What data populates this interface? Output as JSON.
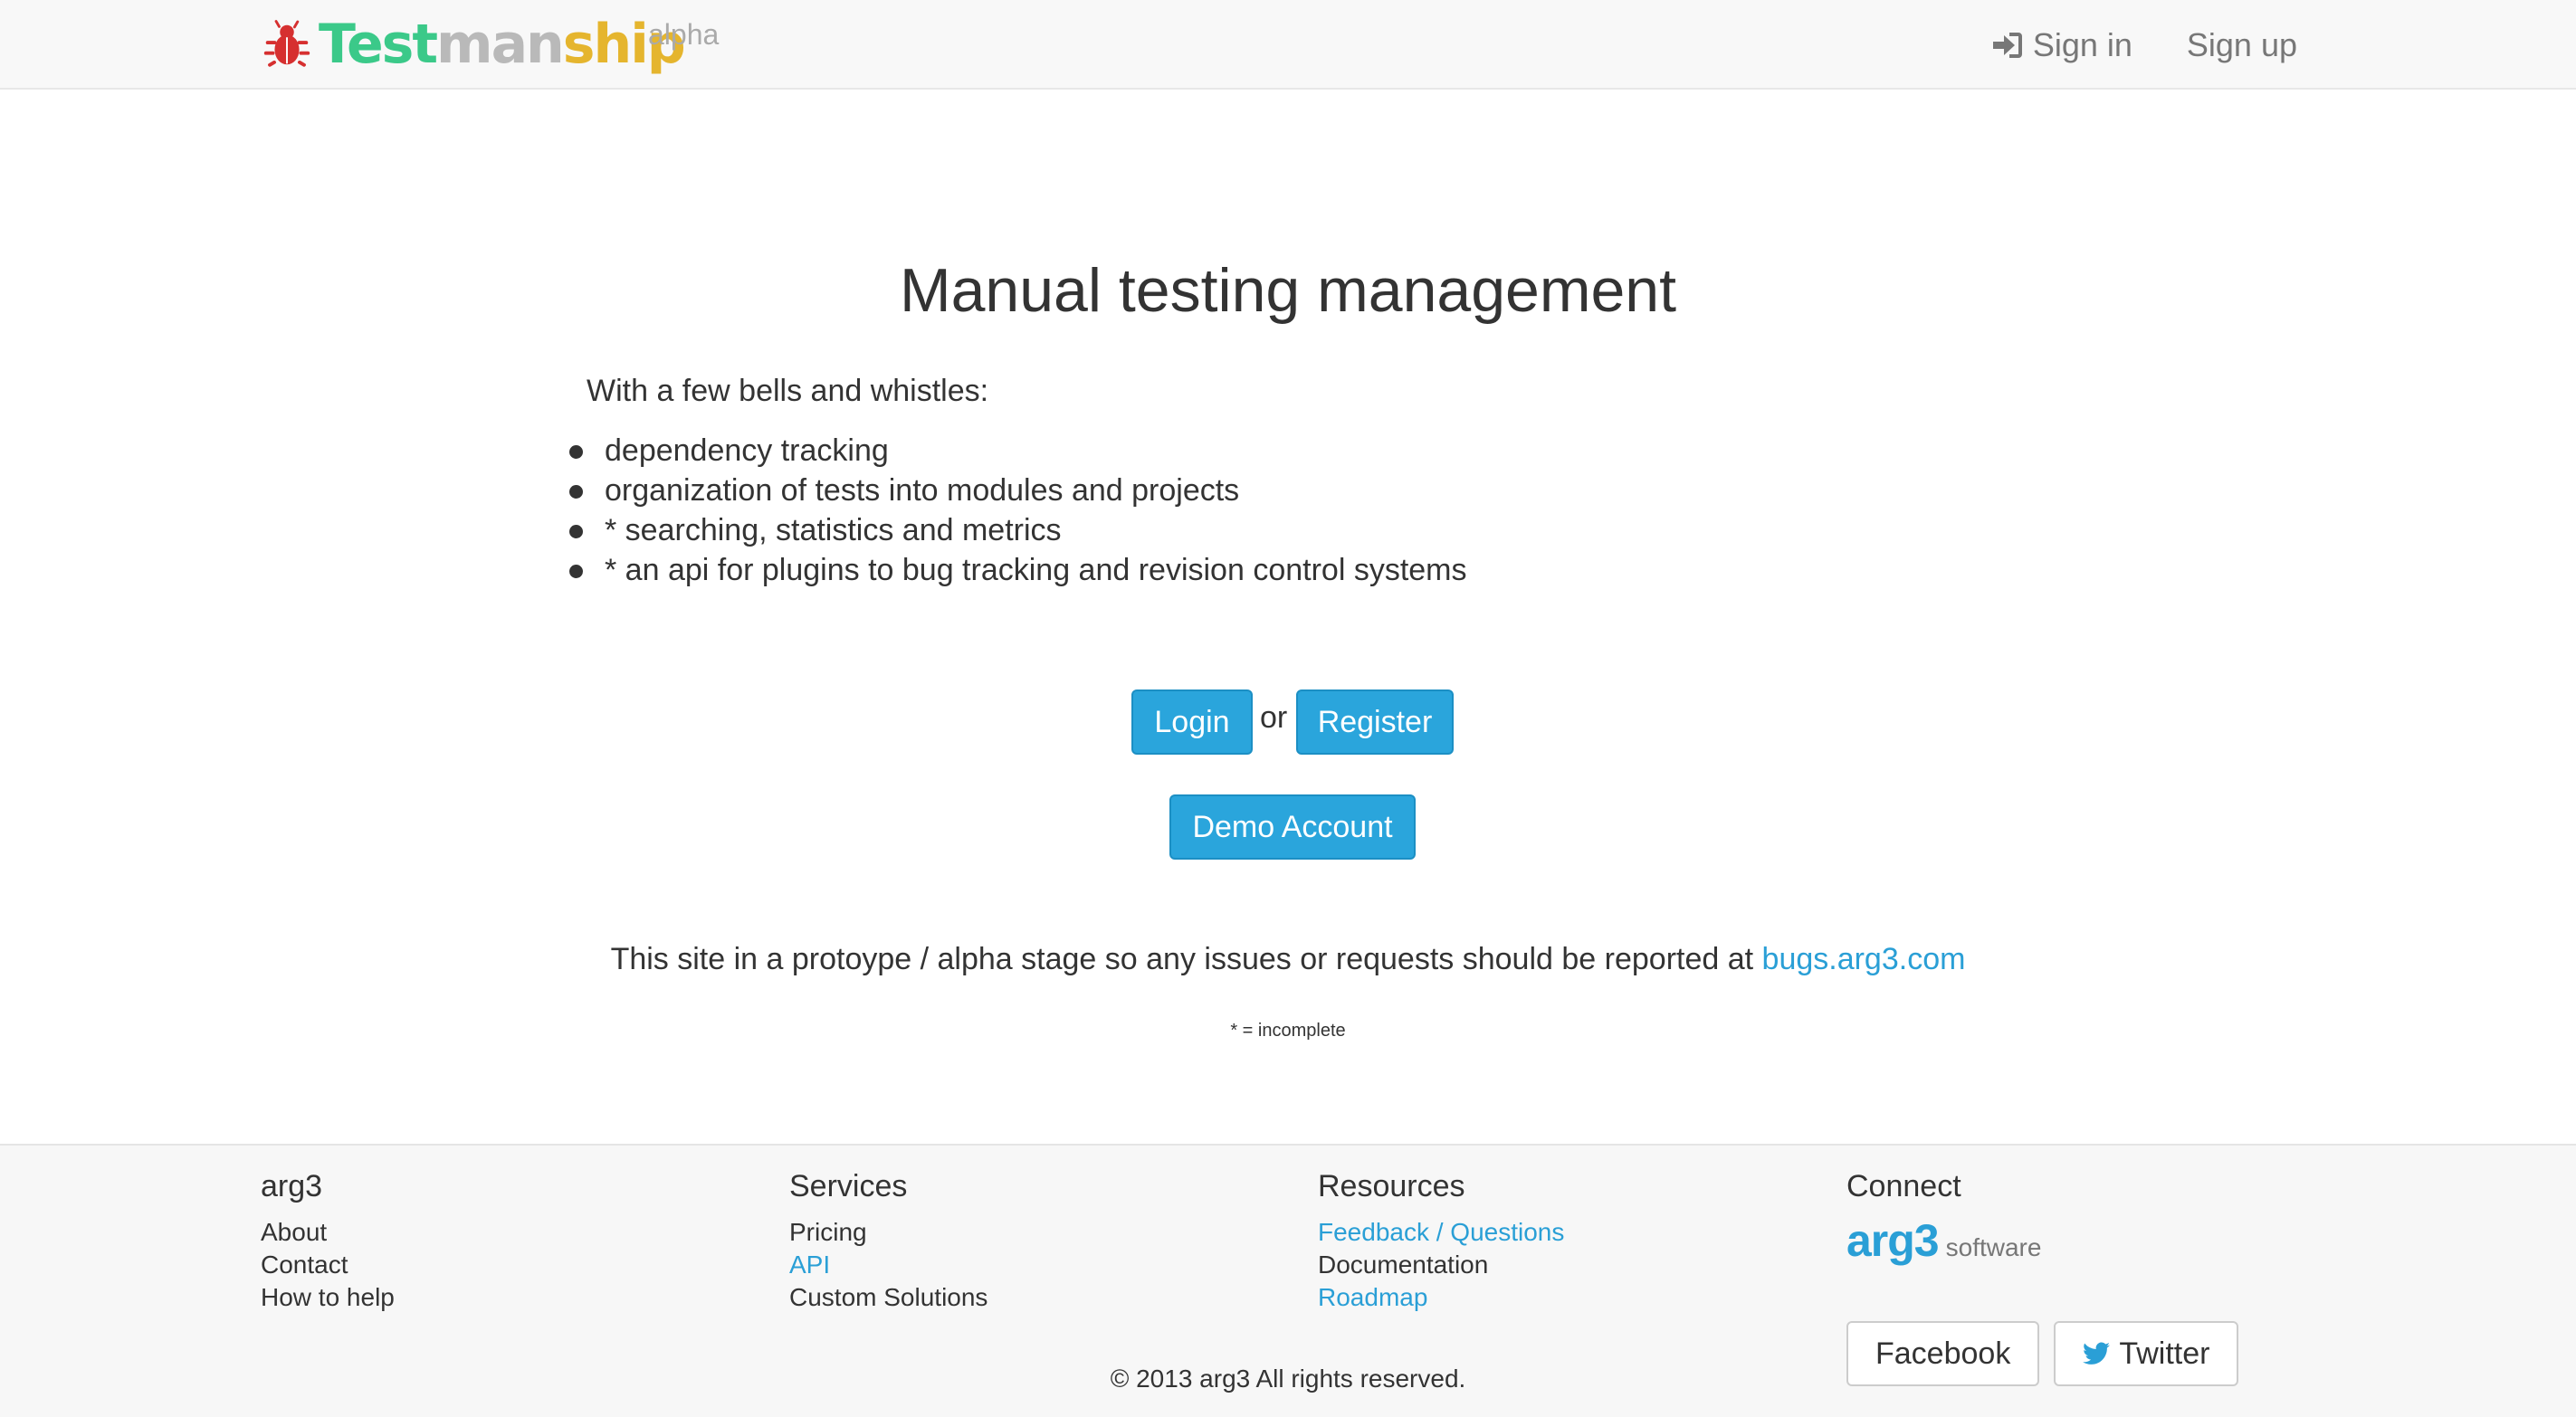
{
  "nav": {
    "brand": {
      "part1": "Test",
      "part2": "man",
      "part3": "ship",
      "tag": "alpha"
    },
    "sign_in": "Sign in",
    "sign_up": "Sign up"
  },
  "main": {
    "title": "Manual testing management",
    "intro": "With a few bells and whistles:",
    "features": [
      "dependency tracking",
      "organization of tests into modules and projects",
      "* searching, statistics and metrics",
      "* an api for plugins to bug tracking and revision control systems"
    ],
    "login_label": "Login",
    "or_text": "or",
    "register_label": "Register",
    "demo_label": "Demo Account",
    "notice_text": "This site in a protoype / alpha stage so any issues or requests should be reported at",
    "notice_link": "bugs.arg3.com",
    "footnote": "* = incomplete"
  },
  "footer": {
    "col1": {
      "heading": "arg3",
      "items": [
        "About",
        "Contact",
        "How to help"
      ]
    },
    "col2": {
      "heading": "Services",
      "items": [
        "Pricing",
        "API",
        "Custom Solutions"
      ]
    },
    "col3": {
      "heading": "Resources",
      "items": [
        "Feedback / Questions",
        "Documentation",
        "Roadmap"
      ]
    },
    "col4": {
      "heading": "Connect",
      "logo_mark": "arg3",
      "logo_sub": "software",
      "facebook": "Facebook",
      "twitter": "Twitter"
    },
    "copyright": "© 2013 arg3 All rights reserved."
  },
  "colors": {
    "accent": "#2aa5dc",
    "link": "#2a9fd6",
    "brand_green": "#3bc989",
    "brand_gray": "#b9b9b9",
    "brand_gold": "#e5b52e",
    "bug_red": "#d63030"
  },
  "icons": [
    "bug-icon",
    "sign-in-icon",
    "twitter-icon"
  ]
}
